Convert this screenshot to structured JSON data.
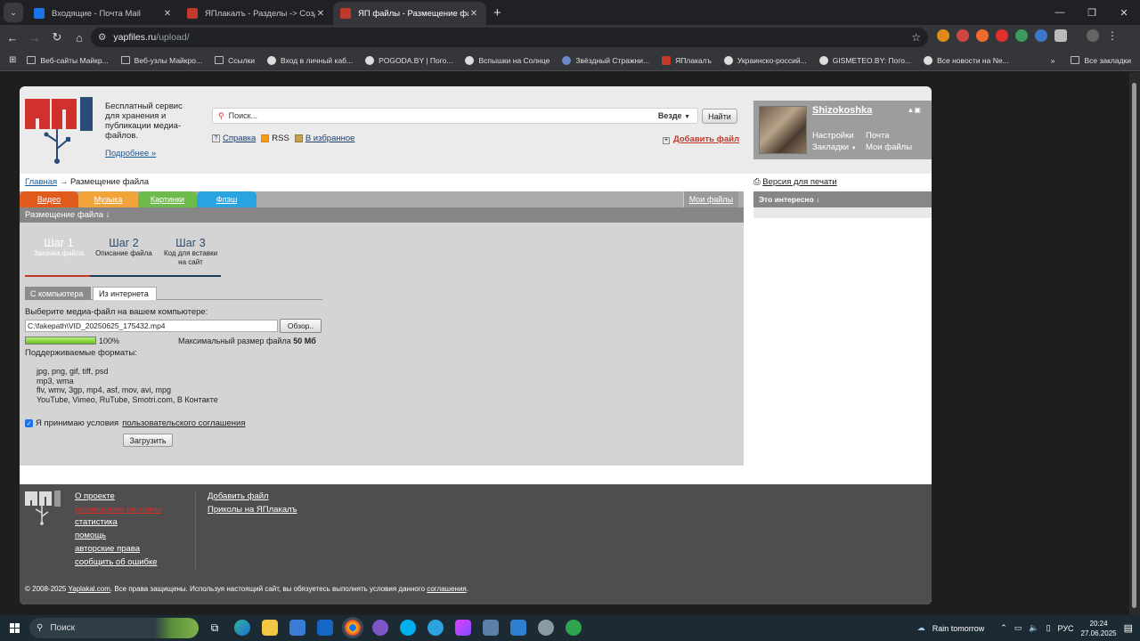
{
  "browser": {
    "tabs": [
      {
        "title": "Входящие - Почта Mail",
        "color": "#1a73e8",
        "active": false
      },
      {
        "title": "ЯПлакалъ - Разделы -> Созда",
        "color": "#c0392b",
        "active": false
      },
      {
        "title": "ЯП файлы - Размещение файл",
        "color": "#c0392b",
        "active": true
      }
    ],
    "url_host": "yapfiles.ru",
    "url_path": "/upload/",
    "bookmarks": [
      "Веб-сайты Майкр...",
      "Веб-узлы Майкро...",
      "Ссылки",
      "Вход в личный каб...",
      "POGODA.BY | Пого...",
      "Вспышки на Солнце",
      "Звёздный Стражни...",
      "ЯПлакалъ",
      "Украинско-россий...",
      "GISMETEO.BY: Пого...",
      "Все новости на Ne..."
    ],
    "all_bookmarks": "Все закладки"
  },
  "header": {
    "tagline": "Бесплатный сервис для хранения и публикации медиа-файлов.",
    "more_link": "Подробнее »",
    "search_placeholder": "Поиск...",
    "search_scope": "Везде",
    "find_button": "Найти",
    "help_link": "Справка",
    "rss_link": "RSS",
    "favorites_link": "В избранное",
    "add_file_link": "Добавить файл"
  },
  "user": {
    "name": "Shizokoshka",
    "settings": "Настройки",
    "bookmarks": "Закладки",
    "mail": "Почта",
    "my_files": "Мои файлы"
  },
  "breadcrumb": {
    "home": "Главная",
    "arrow": "→",
    "current": "Размещение файла"
  },
  "print_version": "Версия для печати",
  "categories": [
    {
      "label": "Видео",
      "color": "#e05a1e"
    },
    {
      "label": "Музыка",
      "color": "#f2a33a"
    },
    {
      "label": "Картинки",
      "color": "#6dbb4a"
    },
    {
      "label": "Флэш",
      "color": "#2aa4e0"
    }
  ],
  "my_files_tab": "Мои файлы",
  "section_title": "Размещение файла ↓",
  "sidebar_title": "Это интересно ↓",
  "steps": [
    {
      "title": "Шаг 1",
      "desc": "Закачка файла"
    },
    {
      "title": "Шаг 2",
      "desc": "Описание файла"
    },
    {
      "title": "Шаг 3",
      "desc": "Код для вставки на сайт"
    }
  ],
  "source_tabs": [
    "С компьютера",
    "Из интернета"
  ],
  "upload": {
    "choose_label": "Выберите медиа-файл на вашем компьютере:",
    "file_path": "C:\\fakepath\\VID_20250625_175432.mp4",
    "browse_button": "Обзор..",
    "progress_percent": 100,
    "progress_label": "100%",
    "max_size_label": "Максимальный размер файла",
    "max_size_value": "50 Мб",
    "formats_title": "Поддерживаемые форматы:",
    "formats": [
      "jpg, png, gif, tiff, psd",
      "mp3, wma",
      "flv, wmv, 3gp, mp4, asf, mov, avi, mpg",
      "YouTube, Vimeo, RuTube, Smotri.com, В Контакте"
    ],
    "agree_text": "Я принимаю условия",
    "agree_link": "пользовательского соглашения",
    "agree_checked": true,
    "submit_button": "Загрузить"
  },
  "footer": {
    "col1": [
      "О проекте",
      "размещение рекламы",
      "статистика",
      "помощь",
      "авторские права",
      "сообщить об ошибке"
    ],
    "col2": [
      "Добавить файл",
      "Приколы на ЯПлакалъ"
    ],
    "copyright_pre": "© 2008-2025",
    "copyright_site": "Yaplakal.com",
    "copyright_mid": ". Все права защищены. Используя настоящий сайт, вы обязуетесь выполнять условия данного",
    "copyright_link": "соглашения",
    "copyright_end": "."
  },
  "taskbar": {
    "search": "Поиск",
    "weather": "Rain tomorrow",
    "lang": "РУС",
    "time": "20:24",
    "date": "27.06.2025"
  }
}
